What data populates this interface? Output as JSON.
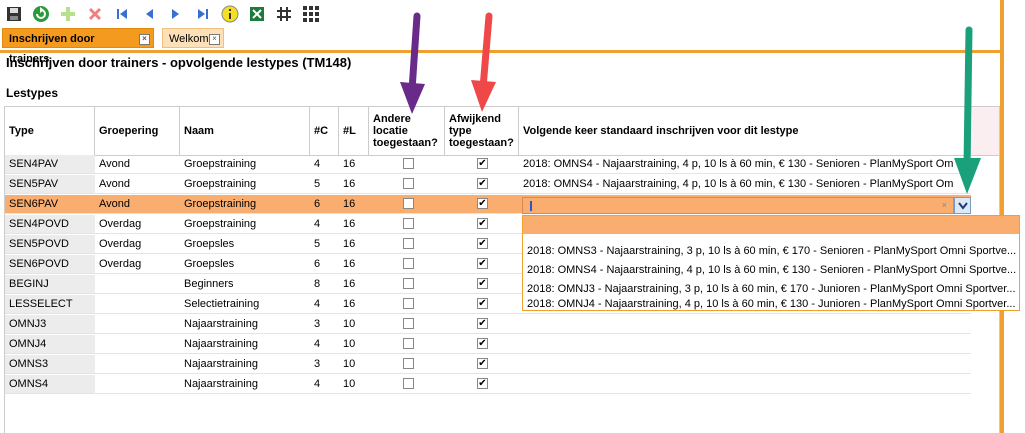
{
  "toolbar": {
    "buttons": [
      {
        "name": "save-icon"
      },
      {
        "name": "refresh-icon"
      },
      {
        "name": "add-icon"
      },
      {
        "name": "delete-icon"
      },
      {
        "name": "first-record-icon"
      },
      {
        "name": "previous-record-icon"
      },
      {
        "name": "next-record-icon"
      },
      {
        "name": "last-record-icon"
      },
      {
        "name": "info-icon"
      },
      {
        "name": "excel-export-icon"
      },
      {
        "name": "grid-small-icon"
      },
      {
        "name": "grid-large-icon"
      }
    ]
  },
  "tabs": [
    {
      "label": "Inschrijven door trainers",
      "active": true
    },
    {
      "label": "Welkom",
      "active": false
    }
  ],
  "page": {
    "title": "Inschrijven door trainers - opvolgende lestypes (TM148)",
    "section": "Lestypes"
  },
  "table": {
    "columns": {
      "type": "Type",
      "groepering": "Groepering",
      "naam": "Naam",
      "c": "#C",
      "l": "#L",
      "andere_1": "Andere",
      "andere_2": "locatie",
      "andere_3": "toegestaan?",
      "afwijkend_1": "Afwijkend",
      "afwijkend_2": "type",
      "afwijkend_3": "toegestaan?",
      "volgende": "Volgende keer standaard inschrijven voor dit lestype"
    },
    "rows": [
      {
        "type": "SEN4PAV",
        "groepering": "Avond",
        "naam": "Groepstraining",
        "c": "4",
        "l": "16",
        "andere": false,
        "afwijkend": true,
        "volgende": "2018: OMNS4 - Najaarstraining, 4 p, 10 ls à 60 min, € 130 - Senioren - PlanMySport Om"
      },
      {
        "type": "SEN5PAV",
        "groepering": "Avond",
        "naam": "Groepstraining",
        "c": "5",
        "l": "16",
        "andere": false,
        "afwijkend": true,
        "volgende": "2018: OMNS4 - Najaarstraining, 4 p, 10 ls à 60 min, € 130 - Senioren - PlanMySport Om"
      },
      {
        "type": "SEN6PAV",
        "groepering": "Avond",
        "naam": "Groepstraining",
        "c": "6",
        "l": "16",
        "andere": false,
        "afwijkend": true,
        "volgende": "",
        "selected": true
      },
      {
        "type": "SEN4POVD",
        "groepering": "Overdag",
        "naam": "Groepstraining",
        "c": "4",
        "l": "16",
        "andere": false,
        "afwijkend": true,
        "volgende": ""
      },
      {
        "type": "SEN5POVD",
        "groepering": "Overdag",
        "naam": "Groepsles",
        "c": "5",
        "l": "16",
        "andere": false,
        "afwijkend": true,
        "volgende": ""
      },
      {
        "type": "SEN6POVD",
        "groepering": "Overdag",
        "naam": "Groepsles",
        "c": "6",
        "l": "16",
        "andere": false,
        "afwijkend": true,
        "volgende": ""
      },
      {
        "type": "BEGINJ",
        "groepering": "",
        "naam": "Beginners",
        "c": "8",
        "l": "16",
        "andere": false,
        "afwijkend": true,
        "volgende": ""
      },
      {
        "type": "LESSELECT",
        "groepering": "",
        "naam": "Selectietraining",
        "c": "4",
        "l": "16",
        "andere": false,
        "afwijkend": true,
        "volgende": ""
      },
      {
        "type": "OMNJ3",
        "groepering": "",
        "naam": "Najaarstraining",
        "c": "3",
        "l": "10",
        "andere": false,
        "afwijkend": true,
        "volgende": ""
      },
      {
        "type": "OMNJ4",
        "groepering": "",
        "naam": "Najaarstraining",
        "c": "4",
        "l": "10",
        "andere": false,
        "afwijkend": true,
        "volgende": ""
      },
      {
        "type": "OMNS3",
        "groepering": "",
        "naam": "Najaarstraining",
        "c": "3",
        "l": "10",
        "andere": false,
        "afwijkend": true,
        "volgende": ""
      },
      {
        "type": "OMNS4",
        "groepering": "",
        "naam": "Najaarstraining",
        "c": "4",
        "l": "10",
        "andere": false,
        "afwijkend": true,
        "volgende": ""
      }
    ]
  },
  "combo": {
    "clear_symbol": "×",
    "options": [
      "2018: OMNS3 - Najaarstraining, 3 p, 10 ls à 60 min, € 170 - Senioren - PlanMySport Omni Sportve...",
      "2018: OMNS4 - Najaarstraining, 4 p, 10 ls à 60 min, € 130 - Senioren - PlanMySport Omni Sportve...",
      "2018: OMNJ3 - Najaarstraining, 3 p, 10 ls à 60 min, € 170 - Junioren - PlanMySport Omni Sportver...",
      "2018: OMNJ4 - Najaarstraining, 4 p, 10 ls à 60 min, € 130 - Junioren - PlanMySport Omni Sportver..."
    ]
  },
  "annotation_arrows": [
    {
      "name": "purple-arrow-icon",
      "color": "#6a2a8a"
    },
    {
      "name": "red-arrow-icon",
      "color": "#f04848"
    },
    {
      "name": "green-arrow-icon",
      "color": "#1aa07a"
    }
  ],
  "colors": {
    "accent": "#f0a030",
    "selected_row": "#f9ae70",
    "tab_active": "#f49a1e"
  }
}
